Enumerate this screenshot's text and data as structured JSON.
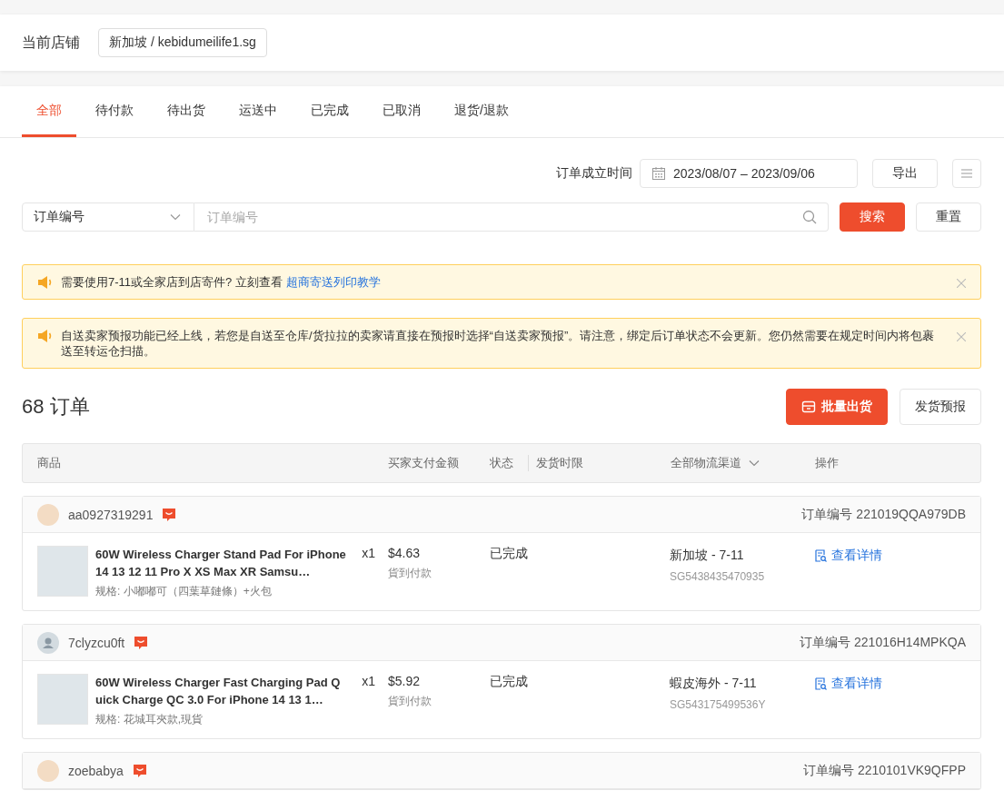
{
  "store": {
    "label": "当前店铺",
    "value": "新加坡 / kebidumeilife1.sg"
  },
  "tabs": [
    {
      "label": "全部",
      "selected": true
    },
    {
      "label": "待付款",
      "selected": false
    },
    {
      "label": "待出货",
      "selected": false
    },
    {
      "label": "运送中",
      "selected": false
    },
    {
      "label": "已完成",
      "selected": false
    },
    {
      "label": "已取消",
      "selected": false
    },
    {
      "label": "退货/退款",
      "selected": false
    }
  ],
  "filters": {
    "date_label": "订单成立时间",
    "date_range": "2023/08/07 – 2023/09/06",
    "export_button": "导出",
    "search_type": "订单编号",
    "search_placeholder": "订单编号",
    "search_button": "搜索",
    "reset_button": "重置"
  },
  "notices": [
    {
      "text": "需要使用7-11或全家店到店寄件? 立刻查看",
      "link": "超商寄送列印教学"
    },
    {
      "text": "自送卖家预报功能已经上线，若您是自送至仓库/货拉拉的卖家请直接在预报时选择“自送卖家预报”。请注意，绑定后订单状态不会更新。您仍然需要在规定时间内将包裹送至转运仓扫描。"
    }
  ],
  "order_count": "68 订单",
  "actions": [
    {
      "label": "批量出货",
      "primary": true
    },
    {
      "label": "发货预报",
      "primary": false
    }
  ],
  "table": {
    "columns": [
      "商品",
      "买家支付金额",
      "状态",
      "发货时限",
      "全部物流渠道",
      "操作"
    ]
  },
  "orders": [
    {
      "buyer": "aa0927319291",
      "kind": "photo",
      "order_label": "订单编号",
      "order_no": "221019QQA979DB",
      "product": "60W Wireless Charger Stand Pad For iPhone 14 13 12 11 Pro X XS Max XR Samsu…",
      "quantity": "x1",
      "variation": "规格: 小嘟嘟可（四葉草鏈條）+火包",
      "price": "$4.63",
      "payment": "貨到付款",
      "status": "已完成",
      "channel": "新加坡 - 7-11",
      "tracking": "SG5438435470935",
      "action": "查看详情"
    },
    {
      "buyer": "7clyzcu0ft",
      "kind": "default",
      "order_label": "订单编号",
      "order_no": "221016H14MPKQA",
      "product": "60W Wireless Charger Fast Charging Pad Quick Charge QC 3.0 For iPhone 14 13 1…",
      "quantity": "x1",
      "variation": "规格: 花城耳夾款,現貨",
      "price": "$5.92",
      "payment": "貨到付款",
      "status": "已完成",
      "channel": "蝦皮海外 - 7-11",
      "tracking": "SG543175499536Y",
      "action": "查看详情"
    },
    {
      "buyer": "zoebabya",
      "kind": "photo",
      "order_label": "订单编号",
      "order_no": "2210101VK9QFPP"
    }
  ]
}
